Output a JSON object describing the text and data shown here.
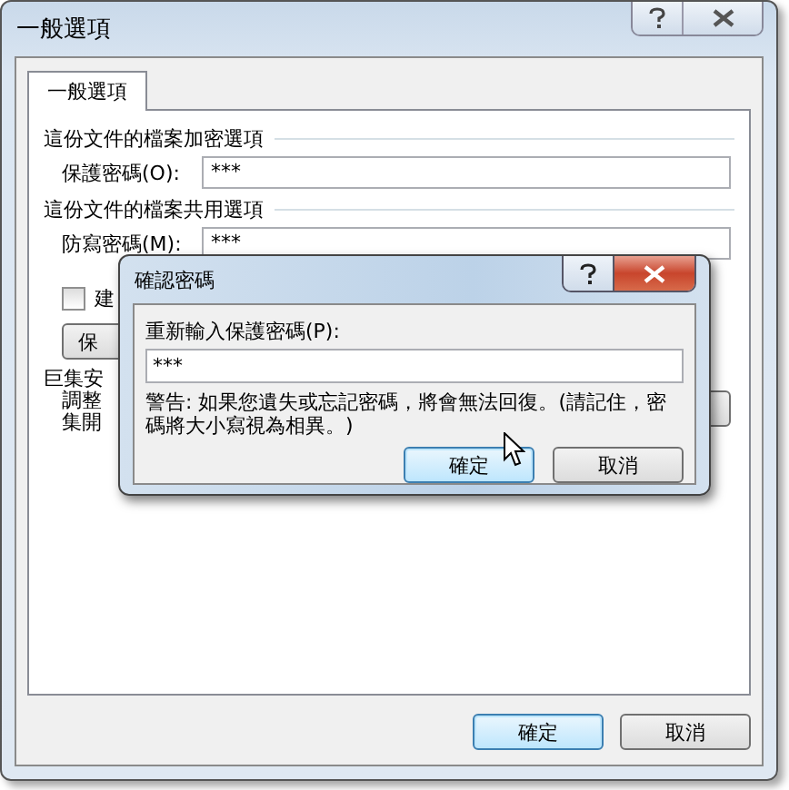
{
  "window": {
    "title": "一般選項"
  },
  "tabs": [
    {
      "label": "一般選項",
      "selected": true
    }
  ],
  "sections": [
    {
      "title": "這份文件的檔案加密選項",
      "field": {
        "label": "保護密碼(O):",
        "value": "***"
      }
    },
    {
      "title": "這份文件的檔案共用選項",
      "field": {
        "label": "防寫密碼(M):",
        "value": "***"
      }
    }
  ],
  "recommend_checkbox": {
    "label": "建",
    "checked": false
  },
  "protect_button": {
    "label": "保"
  },
  "macro_section": {
    "title": "巨集安",
    "lines": [
      "調整",
      "集開"
    ]
  },
  "buttons": [
    {
      "label": "確定",
      "focused": true
    },
    {
      "label": "取消",
      "focused": false
    }
  ],
  "confirm_dialog": {
    "title": "確認密碼",
    "field_label": "重新輸入保護密碼(P):",
    "value": "***",
    "warning": "警告: 如果您遺失或忘記密碼，將會無法回復。(請記住，密碼將大小寫視為相異。)",
    "buttons": [
      {
        "label": "確定",
        "focused": true
      },
      {
        "label": "取消",
        "focused": false
      }
    ]
  }
}
